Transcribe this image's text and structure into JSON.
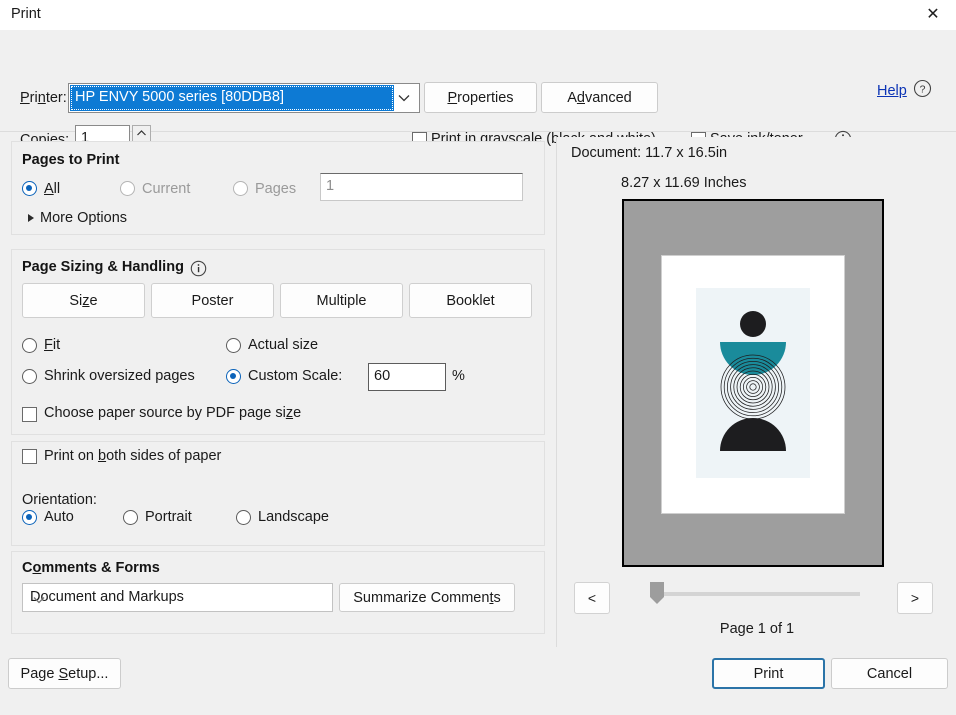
{
  "window": {
    "title": "Print",
    "close_icon": "close-icon"
  },
  "printer": {
    "label": "Printer:",
    "selected": "HP ENVY 5000 series [80DDB8]",
    "dropdown_icon": "chevron-down-icon",
    "properties_label": "Properties",
    "advanced_label": "Advanced",
    "help_label": "Help",
    "help_icon": "question-circle-icon",
    "highlight_color": "#0d7ad4"
  },
  "copies": {
    "label": "Copies:",
    "value": "1",
    "spin_up_icon": "caret-up-icon",
    "spin_down_icon": "caret-down-icon"
  },
  "options": {
    "grayscale_label": "Print in grayscale (black and white)",
    "grayscale_checked": false,
    "save_ink_label": "Save ink/toner",
    "save_ink_checked": false,
    "info_icon": "info-circle-icon"
  },
  "pages_to_print": {
    "title": "Pages to Print",
    "all_label": "All",
    "current_label": "Current",
    "pages_label": "Pages",
    "selected": "All",
    "pages_input_value": "1",
    "more_options_label": "More Options",
    "expand_icon": "triangle-right-icon"
  },
  "page_sizing": {
    "title": "Page Sizing & Handling",
    "info_icon": "info-circle-icon",
    "buttons": [
      {
        "label": "Size"
      },
      {
        "label": "Poster"
      },
      {
        "label": "Multiple"
      },
      {
        "label": "Booklet"
      }
    ],
    "fit_label": "Fit",
    "actual_size_label": "Actual size",
    "shrink_label": "Shrink oversized pages",
    "custom_scale_label": "Custom Scale:",
    "custom_scale_value": "60",
    "percent_label": "%",
    "selected": "Custom Scale",
    "paper_source_label": "Choose paper source by PDF page size",
    "paper_source_checked": false
  },
  "sides": {
    "both_sides_label": "Print on both sides of paper",
    "both_sides_checked": false,
    "orientation_label": "Orientation:",
    "auto_label": "Auto",
    "portrait_label": "Portrait",
    "landscape_label": "Landscape",
    "orientation_selected": "Auto"
  },
  "comments": {
    "title": "Comments & Forms",
    "selected": "Document and Markups",
    "dropdown_icon": "chevron-down-icon",
    "summarize_label": "Summarize Comments"
  },
  "preview": {
    "document_size": "Document: 11.7 x 16.5in",
    "paper_size": "8.27 x 11.69 Inches",
    "prev_label": "<",
    "next_label": ">",
    "page_count": "Page 1 of 1",
    "artwork": {
      "background_color": "#eef4f7",
      "teal_color": "#1a8b9b",
      "dark_color": "#1d1d1f"
    }
  },
  "footer": {
    "page_setup_label": "Page Setup...",
    "print_label": "Print",
    "cancel_label": "Cancel",
    "print_focus_color": "#2b74a8"
  }
}
